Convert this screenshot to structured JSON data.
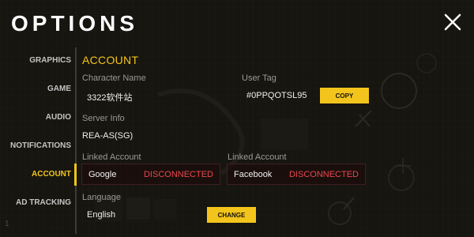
{
  "header": {
    "title": "OPTIONS"
  },
  "sidebar": {
    "items": [
      {
        "label": "GRAPHICS"
      },
      {
        "label": "GAME"
      },
      {
        "label": "AUDIO"
      },
      {
        "label": "NOTIFICATIONS"
      },
      {
        "label": "ACCOUNT",
        "active": true
      },
      {
        "label": "AD TRACKING"
      }
    ]
  },
  "account": {
    "section_title": "ACCOUNT",
    "character_name_label": "Character Name",
    "character_name": "3322软件站",
    "user_tag_label": "User Tag",
    "user_tag": "#0PPQOTSL95",
    "copy_label": "COPY",
    "server_info_label": "Server Info",
    "server_info": "REA-AS(SG)",
    "linked_accounts": [
      {
        "label": "Linked Account",
        "service": "Google",
        "status": "DISCONNECTED"
      },
      {
        "label": "Linked Account",
        "service": "Facebook",
        "status": "DISCONNECTED"
      }
    ],
    "language_label": "Language",
    "language": "English",
    "change_label": "CHANGE"
  },
  "background_hud": {
    "bottom_left": "1"
  },
  "colors": {
    "accent": "#f4c51c",
    "disconnected": "#e8474f",
    "background": "#15140f"
  }
}
